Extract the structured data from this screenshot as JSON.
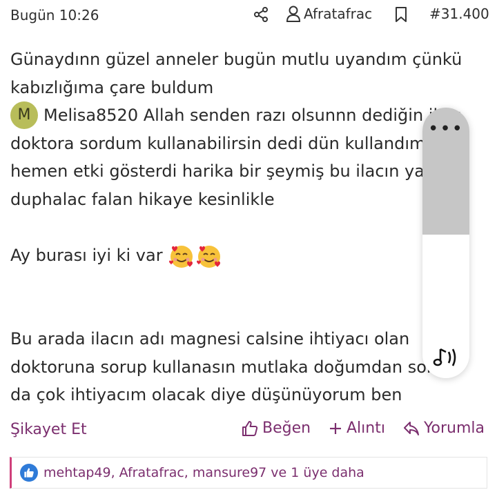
{
  "header": {
    "time": "Bugün 10:26",
    "author": "Afratafrac",
    "post_number": "#31.400",
    "icons": [
      "share-icon",
      "user-icon",
      "bookmark-icon"
    ]
  },
  "post": {
    "line1": "Günaydınn güzel anneler bugün mutlu uyandım çünkü",
    "line2": "kabızlığıma çare buldum",
    "quote_avatar_letter": "M",
    "quote_line": "Melisa8520 Allah senden razı olsunnn dediğin ilacı",
    "line4": "doktora sordum kullanabilirsin dedi dün kullandım",
    "line5": "hemen etki gösterdi harika bir şeymiş bu ilacın yanında",
    "line6": "duphalac falan hikaye kesinlikle",
    "line7": "Ay burası iyi ki var",
    "line8": "Bu arada ilacın adı magnesi calsine ihtiyacı olan",
    "line9": "doktoruna sorup kullanasın mutlaka doğumdan sonra",
    "line10": "da çok ihtiyacım olacak diye düşünüyorum ben"
  },
  "actions": {
    "report": "Şikayet Et",
    "like": "Beğen",
    "quote": "Alıntı",
    "reply": "Yorumla"
  },
  "likes": {
    "text": "mehtap49, Afratafrac, mansure97 ve 1 üye daha"
  },
  "overlay": {
    "menu_dots": "•••"
  },
  "colors": {
    "accent": "#7b2e6e",
    "likes_border": "#cf3f7a",
    "like_badge": "#2f7bd8",
    "avatar": "#b8bd5a"
  }
}
